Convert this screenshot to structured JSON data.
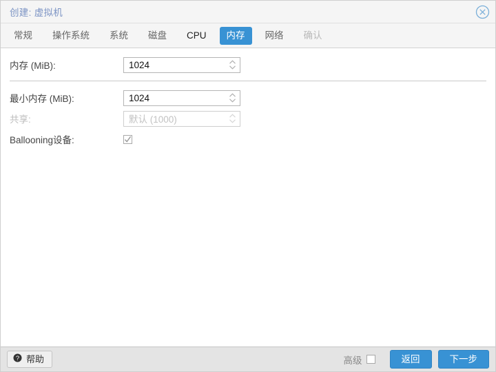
{
  "window": {
    "title": "创建: 虚拟机",
    "close_icon": "close-circle-icon"
  },
  "tabs": [
    {
      "label": "常规",
      "state": "normal"
    },
    {
      "label": "操作系统",
      "state": "normal"
    },
    {
      "label": "系统",
      "state": "normal"
    },
    {
      "label": "磁盘",
      "state": "normal"
    },
    {
      "label": "CPU",
      "state": "normal"
    },
    {
      "label": "内存",
      "state": "active"
    },
    {
      "label": "网络",
      "state": "normal"
    },
    {
      "label": "确认",
      "state": "disabled"
    }
  ],
  "form": {
    "memory": {
      "label": "内存 (MiB):",
      "value": "1024",
      "placeholder": "",
      "disabled": false
    },
    "min_memory": {
      "label": "最小内存 (MiB):",
      "value": "1024",
      "placeholder": "",
      "disabled": false
    },
    "shares": {
      "label": "共享:",
      "value": "",
      "placeholder": "默认 (1000)",
      "disabled": true
    },
    "ballooning": {
      "label": "Ballooning设备:",
      "checked": true
    }
  },
  "footer": {
    "help_label": "帮助",
    "help_icon": "question-circle-icon",
    "advanced_label": "高级",
    "advanced_checked": false,
    "back_label": "返回",
    "next_label": "下一步"
  },
  "colors": {
    "accent": "#3892d4",
    "title_text": "#7b93c4",
    "tab_text": "#666666",
    "disabled_text": "#bdbdbd",
    "footer_bg": "#e4e4e4"
  }
}
